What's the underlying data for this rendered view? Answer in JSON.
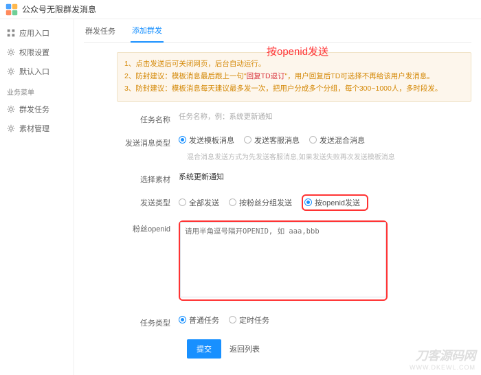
{
  "app": {
    "title": "公众号无限群发消息"
  },
  "sidebar": {
    "items": [
      {
        "label": "应用入口",
        "icon": "grid"
      },
      {
        "label": "权限设置",
        "icon": "gear"
      },
      {
        "label": "默认入口",
        "icon": "gear"
      }
    ],
    "section_label": "业务菜单",
    "biz": [
      {
        "label": "群发任务",
        "icon": "gear"
      },
      {
        "label": "素材管理",
        "icon": "gear"
      }
    ]
  },
  "tabs": {
    "list": "群发任务",
    "add": "添加群发"
  },
  "annotation": "按openid发送",
  "notice": {
    "l1a": "1、点击发送后可关闭网页，后台自动运行。",
    "l2a": "2、防封建议：模板消息最后跟上一句\"",
    "l2b": "回复TD退订",
    "l2c": "\"，用户回复后TD可选择不再给该用户发消息。",
    "l3a": "3、防封建议：模板消息每天建议最多发一次，把用户分成多个分组，每个300~1000人，多时段发。"
  },
  "form": {
    "task_name_label": "任务名称",
    "task_name_ph": "任务名称，例：系统更新通知",
    "msg_type_label": "发送消息类型",
    "msg_type_opts": {
      "tpl": "发送模板消息",
      "cs": "发送客服消息",
      "mix": "发送混合消息"
    },
    "msg_type_hint": "混合消息发送方式为先发送客服消息,如果发送失败再次发送模板消息",
    "material_label": "选择素材",
    "material_value": "系统更新通知",
    "send_type_label": "发送类型",
    "send_type_opts": {
      "all": "全部发送",
      "group": "按粉丝分组发送",
      "openid": "按openid发送"
    },
    "openid_label": "粉丝openid",
    "openid_ph": "请用半角逗号隔开OPENID, 如 aaa,bbb",
    "task_type_label": "任务类型",
    "task_type_opts": {
      "normal": "普通任务",
      "timed": "定时任务"
    },
    "submit": "提交",
    "back": "返回列表"
  },
  "watermark": {
    "line1": "刀客源码网",
    "line2": "WWW.DKEWL.COM"
  }
}
